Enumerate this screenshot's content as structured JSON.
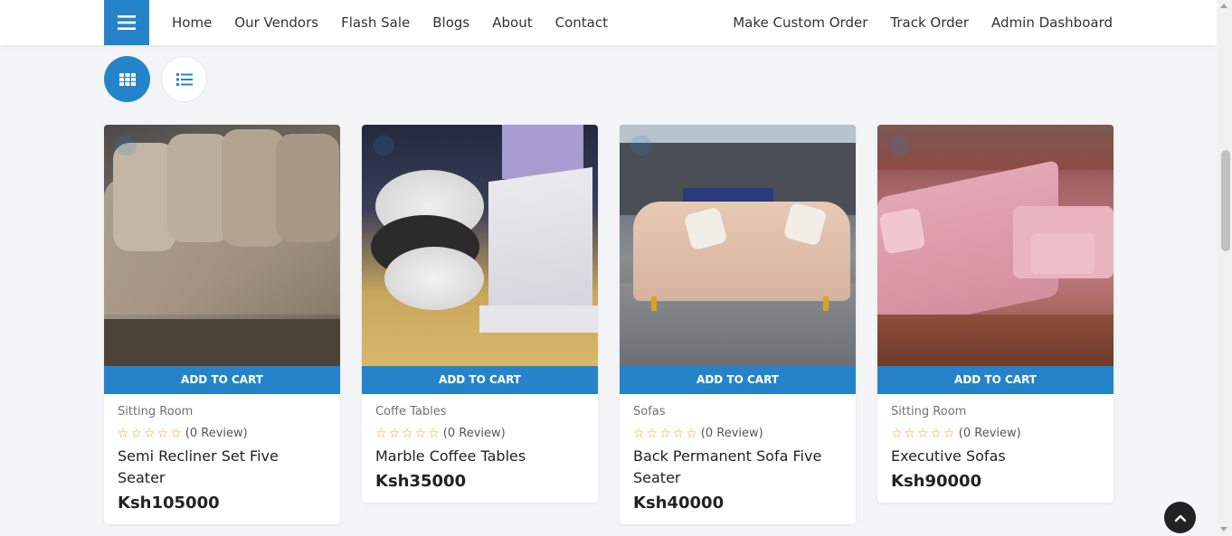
{
  "nav": {
    "left_links": [
      "Home",
      "Our Vendors",
      "Flash Sale",
      "Blogs",
      "About",
      "Contact"
    ],
    "right_links": [
      "Make Custom Order",
      "Track Order",
      "Admin Dashboard"
    ],
    "menu_icon": "hamburger-icon"
  },
  "view_toggle": {
    "grid_icon": "grid-icon",
    "list_icon": "list-icon",
    "active": "grid"
  },
  "products": [
    {
      "category": "Sitting Room",
      "stars": "☆☆☆☆☆",
      "reviews": "(0 Review)",
      "title": "Semi Recliner Set Five Seater",
      "price": "Ksh105000",
      "cart_label": "ADD TO CART"
    },
    {
      "category": "Coffe Tables",
      "stars": "☆☆☆☆☆",
      "reviews": "(0 Review)",
      "title": "Marble Coffee Tables",
      "price": "Ksh35000",
      "cart_label": "ADD TO CART"
    },
    {
      "category": "Sofas",
      "stars": "☆☆☆☆☆",
      "reviews": "(0 Review)",
      "title": "Back Permanent Sofa Five Seater",
      "price": "Ksh40000",
      "cart_label": "ADD TO CART"
    },
    {
      "category": "Sitting Room",
      "stars": "☆☆☆☆☆",
      "reviews": "(0 Review)",
      "title": "Executive Sofas",
      "price": "Ksh90000",
      "cart_label": "ADD TO CART"
    }
  ],
  "colors": {
    "accent": "#2584c9",
    "star": "#f0a419",
    "background": "#f4f5f7"
  },
  "back_to_top_icon": "chevron-up-icon"
}
